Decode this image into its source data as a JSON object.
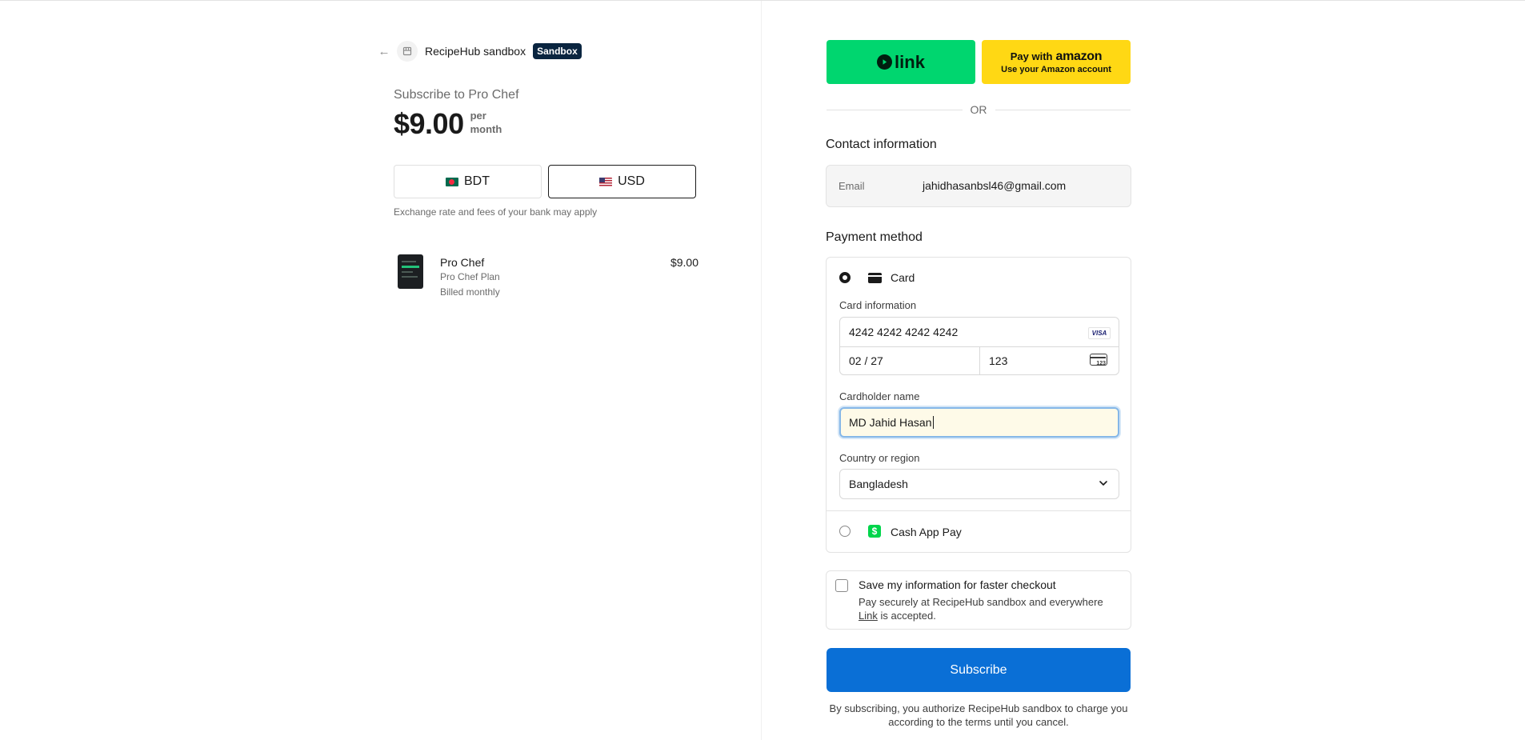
{
  "store": {
    "name": "RecipeHub sandbox",
    "badge": "Sandbox"
  },
  "summary": {
    "subscribe_label": "Subscribe to Pro Chef",
    "price": "$9.00",
    "period_line1": "per",
    "period_line2": "month"
  },
  "currency": {
    "options": [
      {
        "code": "BDT",
        "selected": false
      },
      {
        "code": "USD",
        "selected": true
      }
    ],
    "note": "Exchange rate and fees of your bank may apply"
  },
  "line_item": {
    "name": "Pro Chef",
    "description": "Pro Chef Plan",
    "billing": "Billed monthly",
    "price": "$9.00"
  },
  "express": {
    "link_label": "link",
    "amazon_line1": "Pay with",
    "amazon_word": "amazon",
    "amazon_line2": "Use your Amazon account",
    "or_text": "OR"
  },
  "contact": {
    "title": "Contact information",
    "email_label": "Email",
    "email_value": "jahidhasanbsl46@gmail.com"
  },
  "payment": {
    "title": "Payment method",
    "card_option_label": "Card",
    "card_info_label": "Card information",
    "card_number": "4242 4242 4242 4242",
    "card_brand": "VISA",
    "expiry": "02 / 27",
    "cvc": "123",
    "cardholder_label": "Cardholder name",
    "cardholder_value": "MD Jahid Hasan",
    "country_label": "Country or region",
    "country_value": "Bangladesh",
    "cash_app_label": "Cash App Pay",
    "cash_app_glyph": "$"
  },
  "save_info": {
    "title": "Save my information for faster checkout",
    "desc_before": "Pay securely at RecipeHub sandbox and everywhere ",
    "link_text": "Link",
    "desc_after": " is accepted."
  },
  "actions": {
    "subscribe_label": "Subscribe",
    "legal": "By subscribing, you authorize RecipeHub sandbox to charge you according to the terms until you cancel."
  },
  "colors": {
    "link_green": "#00d66f",
    "amazon_yellow": "#ffd814",
    "subscribe_blue": "#0a6fd6",
    "badge_navy": "#0a2540",
    "cash_app_green": "#00d54b"
  }
}
